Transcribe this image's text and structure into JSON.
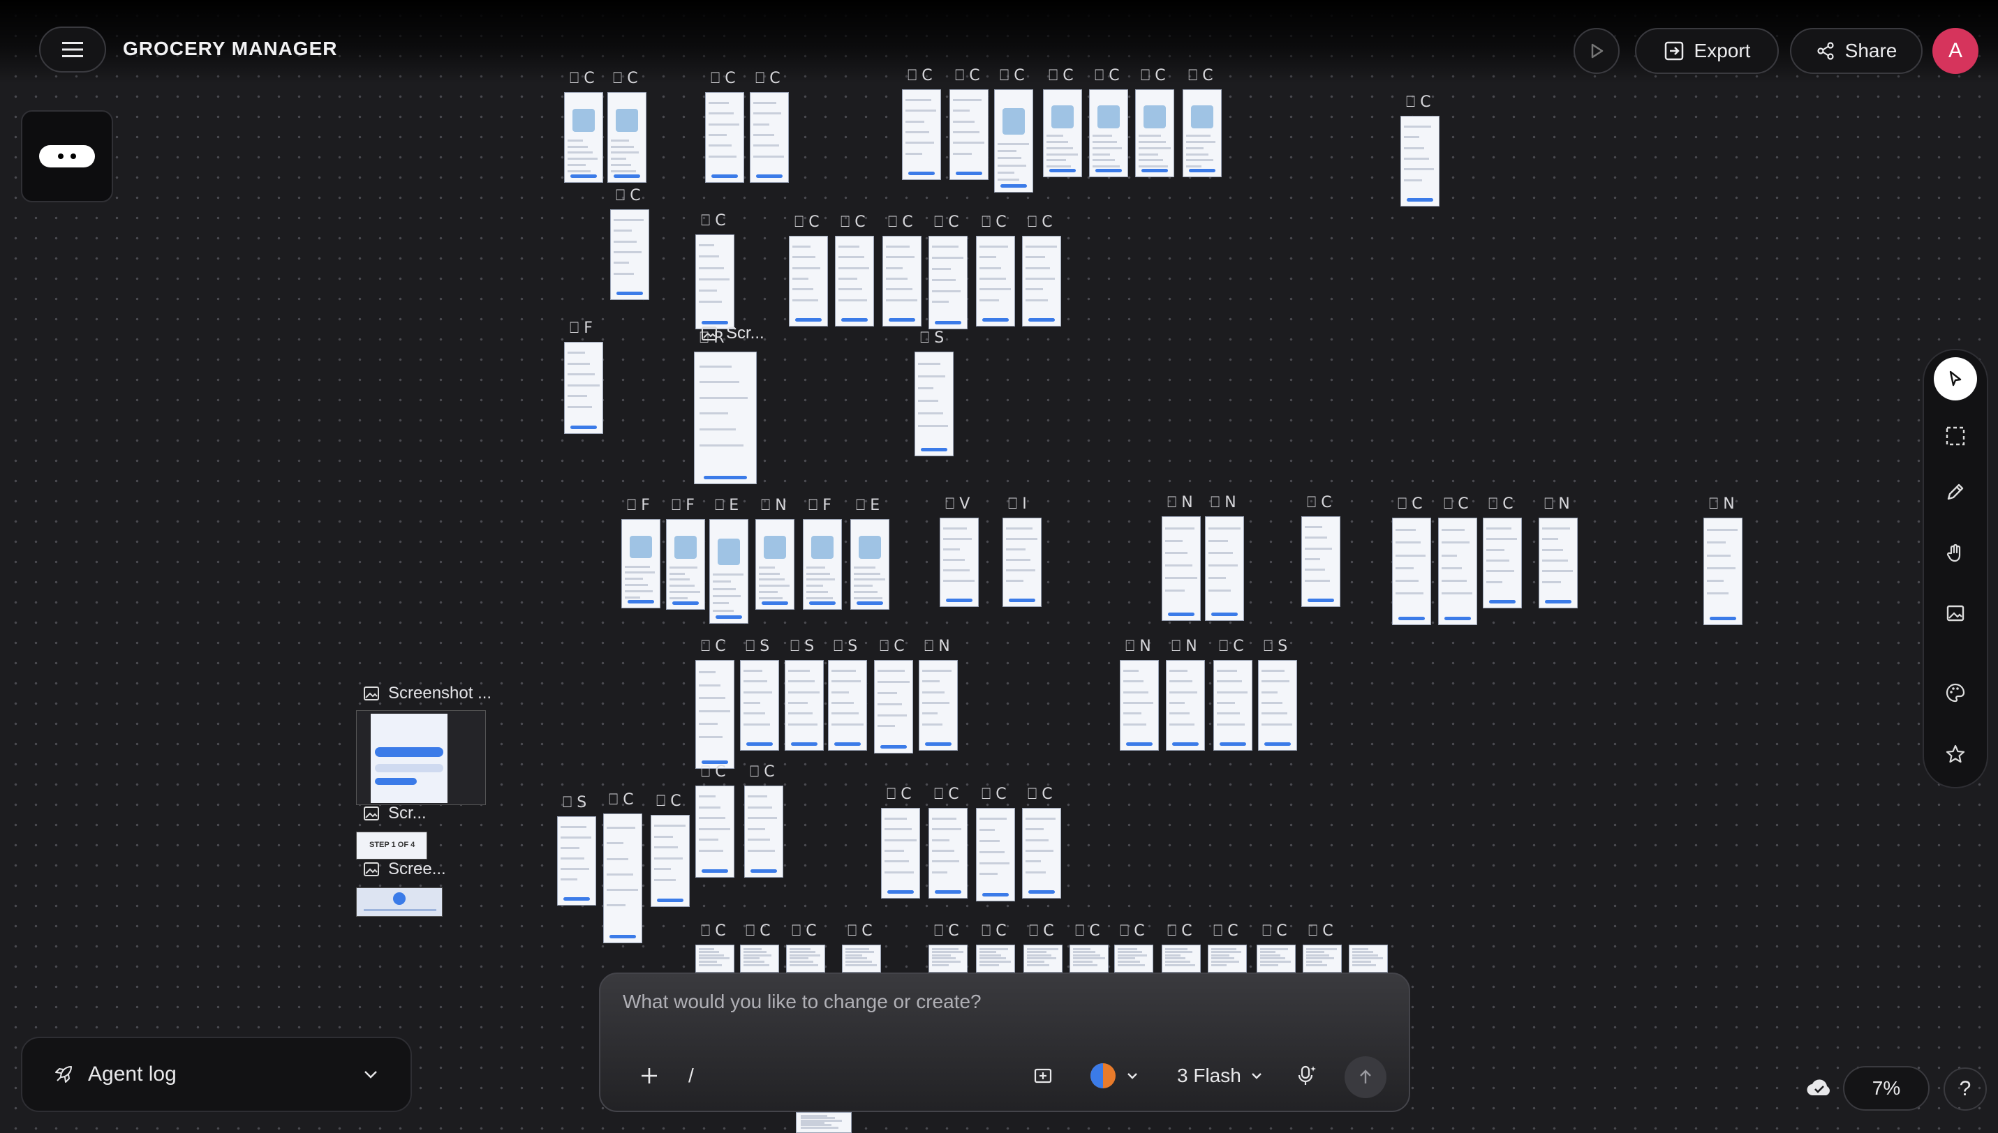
{
  "app": {
    "title": "GROCERY MANAGER"
  },
  "header": {
    "export_label": "Export",
    "share_label": "Share",
    "avatar_initial": "A",
    "icons": [
      "menu-icon",
      "play-icon",
      "export-icon",
      "share-icon"
    ]
  },
  "toolbar": {
    "tools": [
      "pointer-icon",
      "marquee-select-icon",
      "pencil-icon",
      "hand-icon",
      "image-icon",
      "palette-icon",
      "star-icon"
    ],
    "active_tool": "pointer-icon"
  },
  "canvas": {
    "frame_label_snippets": [
      "C",
      "C",
      "C",
      "C",
      "C",
      "C",
      "C",
      "C",
      "C",
      "C",
      "C",
      "C",
      "C",
      "C",
      "C",
      "C",
      "C",
      "C",
      "C",
      "C",
      "F",
      "R",
      "S",
      "F",
      "F",
      "E",
      "N",
      "F",
      "E",
      "V",
      "I",
      "N",
      "N",
      "C",
      "C",
      "C",
      "C",
      "N",
      "N",
      "C",
      "S",
      "S",
      "S",
      "C",
      "N",
      "N",
      "N",
      "C",
      "S",
      "S",
      "C"
    ],
    "screenshot_labels": [
      "Scr...",
      "Screenshot ...",
      "Scr...",
      "Scree..."
    ],
    "step_badge": "STEP 1 OF 4"
  },
  "prompt": {
    "placeholder": "What would you like to change or create?",
    "slash": "/",
    "model_label": "3 Flash"
  },
  "agent_log": {
    "label": "Agent log"
  },
  "status": {
    "zoom": "7%",
    "help": "?"
  },
  "colors": {
    "accent": "#3b7be8",
    "avatar": "#d6345c",
    "canvas": "#1c1c1f"
  }
}
